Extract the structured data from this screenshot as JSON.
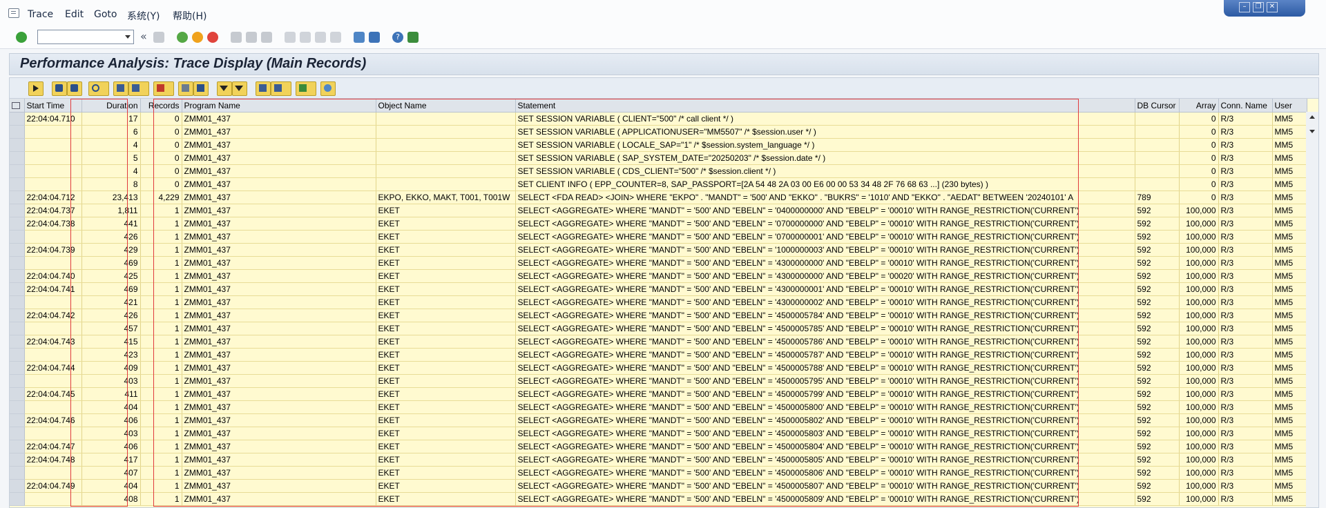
{
  "menu": {
    "items": [
      "Trace",
      "Edit",
      "Goto",
      "系统(Y)",
      "帮助(H)"
    ]
  },
  "command_field": {
    "value": ""
  },
  "window": {
    "title": "Performance Analysis: Trace Display (Main Records)"
  },
  "table": {
    "columns": [
      "Start Time",
      "Duration",
      "Records",
      "Program Name",
      "Object Name",
      "Statement",
      "DB Cursor",
      "Array",
      "Conn. Name",
      "User"
    ],
    "rows": [
      [
        "22:04:04.710",
        "17",
        "0",
        "ZMM01_437",
        "",
        "SET SESSION VARIABLE ( CLIENT=\"500\" /* call client */ )",
        "",
        "0",
        "R/3",
        "MM5"
      ],
      [
        "",
        "6",
        "0",
        "ZMM01_437",
        "",
        "SET SESSION VARIABLE ( APPLICATIONUSER=\"MM5507\" /* $session.user */ )",
        "",
        "0",
        "R/3",
        "MM5"
      ],
      [
        "",
        "4",
        "0",
        "ZMM01_437",
        "",
        "SET SESSION VARIABLE ( LOCALE_SAP=\"1\" /* $session.system_language */ )",
        "",
        "0",
        "R/3",
        "MM5"
      ],
      [
        "",
        "5",
        "0",
        "ZMM01_437",
        "",
        "SET SESSION VARIABLE ( SAP_SYSTEM_DATE=\"20250203\" /* $session.date */ )",
        "",
        "0",
        "R/3",
        "MM5"
      ],
      [
        "",
        "4",
        "0",
        "ZMM01_437",
        "",
        "SET SESSION VARIABLE ( CDS_CLIENT=\"500\" /* $session.client */ )",
        "",
        "0",
        "R/3",
        "MM5"
      ],
      [
        "",
        "8",
        "0",
        "ZMM01_437",
        "",
        "SET CLIENT INFO ( EPP_COUNTER=8, SAP_PASSPORT=[2A 54 48 2A 03 00 E6 00 00 53 34 48 2F 76 68 63 ...] (230 bytes) )",
        "",
        "0",
        "R/3",
        "MM5"
      ],
      [
        "22:04:04.712",
        "23,413",
        "4,229",
        "ZMM01_437",
        "EKPO, EKKO, MAKT, T001, T001W",
        "SELECT <FDA READ> <JOIN>  WHERE \"EKPO\" . \"MANDT\" = '500' AND \"EKKO\" . \"BUKRS\" = '1010' AND \"EKKO\" . \"AEDAT\" BETWEEN '20240101' A",
        "789",
        "0",
        "R/3",
        "MM5"
      ],
      [
        "22:04:04.737",
        "1,811",
        "1",
        "ZMM01_437",
        "EKET",
        "SELECT <AGGREGATE>  WHERE \"MANDT\" = '500' AND \"EBELN\" = '0400000000' AND \"EBELP\" = '00010'   WITH RANGE_RESTRICTION('CURRENT')",
        "592",
        "100,000",
        "R/3",
        "MM5"
      ],
      [
        "22:04:04.738",
        "441",
        "1",
        "ZMM01_437",
        "EKET",
        "SELECT <AGGREGATE>  WHERE \"MANDT\" = '500' AND \"EBELN\" = '0700000000' AND \"EBELP\" = '00010'   WITH RANGE_RESTRICTION('CURRENT')",
        "592",
        "100,000",
        "R/3",
        "MM5"
      ],
      [
        "",
        "426",
        "1",
        "ZMM01_437",
        "EKET",
        "SELECT <AGGREGATE>  WHERE \"MANDT\" = '500' AND \"EBELN\" = '0700000001' AND \"EBELP\" = '00010'   WITH RANGE_RESTRICTION('CURRENT')",
        "592",
        "100,000",
        "R/3",
        "MM5"
      ],
      [
        "22:04:04.739",
        "429",
        "1",
        "ZMM01_437",
        "EKET",
        "SELECT <AGGREGATE>  WHERE \"MANDT\" = '500' AND \"EBELN\" = '1000000003' AND \"EBELP\" = '00010'   WITH RANGE_RESTRICTION('CURRENT')",
        "592",
        "100,000",
        "R/3",
        "MM5"
      ],
      [
        "",
        "469",
        "1",
        "ZMM01_437",
        "EKET",
        "SELECT <AGGREGATE>  WHERE \"MANDT\" = '500' AND \"EBELN\" = '4300000000' AND \"EBELP\" = '00010'   WITH RANGE_RESTRICTION('CURRENT')",
        "592",
        "100,000",
        "R/3",
        "MM5"
      ],
      [
        "22:04:04.740",
        "425",
        "1",
        "ZMM01_437",
        "EKET",
        "SELECT <AGGREGATE>  WHERE \"MANDT\" = '500' AND \"EBELN\" = '4300000000' AND \"EBELP\" = '00020'   WITH RANGE_RESTRICTION('CURRENT')",
        "592",
        "100,000",
        "R/3",
        "MM5"
      ],
      [
        "22:04:04.741",
        "469",
        "1",
        "ZMM01_437",
        "EKET",
        "SELECT <AGGREGATE>  WHERE \"MANDT\" = '500' AND \"EBELN\" = '4300000001' AND \"EBELP\" = '00010'   WITH RANGE_RESTRICTION('CURRENT')",
        "592",
        "100,000",
        "R/3",
        "MM5"
      ],
      [
        "",
        "421",
        "1",
        "ZMM01_437",
        "EKET",
        "SELECT <AGGREGATE>  WHERE \"MANDT\" = '500' AND \"EBELN\" = '4300000002' AND \"EBELP\" = '00010'   WITH RANGE_RESTRICTION('CURRENT')",
        "592",
        "100,000",
        "R/3",
        "MM5"
      ],
      [
        "22:04:04.742",
        "426",
        "1",
        "ZMM01_437",
        "EKET",
        "SELECT <AGGREGATE>  WHERE \"MANDT\" = '500' AND \"EBELN\" = '4500005784' AND \"EBELP\" = '00010'   WITH RANGE_RESTRICTION('CURRENT')",
        "592",
        "100,000",
        "R/3",
        "MM5"
      ],
      [
        "",
        "457",
        "1",
        "ZMM01_437",
        "EKET",
        "SELECT <AGGREGATE>  WHERE \"MANDT\" = '500' AND \"EBELN\" = '4500005785' AND \"EBELP\" = '00010'   WITH RANGE_RESTRICTION('CURRENT')",
        "592",
        "100,000",
        "R/3",
        "MM5"
      ],
      [
        "22:04:04.743",
        "415",
        "1",
        "ZMM01_437",
        "EKET",
        "SELECT <AGGREGATE>  WHERE \"MANDT\" = '500' AND \"EBELN\" = '4500005786' AND \"EBELP\" = '00010'   WITH RANGE_RESTRICTION('CURRENT')",
        "592",
        "100,000",
        "R/3",
        "MM5"
      ],
      [
        "",
        "423",
        "1",
        "ZMM01_437",
        "EKET",
        "SELECT <AGGREGATE>  WHERE \"MANDT\" = '500' AND \"EBELN\" = '4500005787' AND \"EBELP\" = '00010'   WITH RANGE_RESTRICTION('CURRENT')",
        "592",
        "100,000",
        "R/3",
        "MM5"
      ],
      [
        "22:04:04.744",
        "409",
        "1",
        "ZMM01_437",
        "EKET",
        "SELECT <AGGREGATE>  WHERE \"MANDT\" = '500' AND \"EBELN\" = '4500005788' AND \"EBELP\" = '00010'   WITH RANGE_RESTRICTION('CURRENT')",
        "592",
        "100,000",
        "R/3",
        "MM5"
      ],
      [
        "",
        "403",
        "1",
        "ZMM01_437",
        "EKET",
        "SELECT <AGGREGATE>  WHERE \"MANDT\" = '500' AND \"EBELN\" = '4500005795' AND \"EBELP\" = '00010'   WITH RANGE_RESTRICTION('CURRENT')",
        "592",
        "100,000",
        "R/3",
        "MM5"
      ],
      [
        "22:04:04.745",
        "411",
        "1",
        "ZMM01_437",
        "EKET",
        "SELECT <AGGREGATE>  WHERE \"MANDT\" = '500' AND \"EBELN\" = '4500005799' AND \"EBELP\" = '00010'   WITH RANGE_RESTRICTION('CURRENT')",
        "592",
        "100,000",
        "R/3",
        "MM5"
      ],
      [
        "",
        "404",
        "1",
        "ZMM01_437",
        "EKET",
        "SELECT <AGGREGATE>  WHERE \"MANDT\" = '500' AND \"EBELN\" = '4500005800' AND \"EBELP\" = '00010'   WITH RANGE_RESTRICTION('CURRENT')",
        "592",
        "100,000",
        "R/3",
        "MM5"
      ],
      [
        "22:04:04.746",
        "406",
        "1",
        "ZMM01_437",
        "EKET",
        "SELECT <AGGREGATE>  WHERE \"MANDT\" = '500' AND \"EBELN\" = '4500005802' AND \"EBELP\" = '00010'   WITH RANGE_RESTRICTION('CURRENT')",
        "592",
        "100,000",
        "R/3",
        "MM5"
      ],
      [
        "",
        "403",
        "1",
        "ZMM01_437",
        "EKET",
        "SELECT <AGGREGATE>  WHERE \"MANDT\" = '500' AND \"EBELN\" = '4500005803' AND \"EBELP\" = '00010'   WITH RANGE_RESTRICTION('CURRENT')",
        "592",
        "100,000",
        "R/3",
        "MM5"
      ],
      [
        "22:04:04.747",
        "406",
        "1",
        "ZMM01_437",
        "EKET",
        "SELECT <AGGREGATE>  WHERE \"MANDT\" = '500' AND \"EBELN\" = '4500005804' AND \"EBELP\" = '00010'   WITH RANGE_RESTRICTION('CURRENT')",
        "592",
        "100,000",
        "R/3",
        "MM5"
      ],
      [
        "22:04:04.748",
        "417",
        "1",
        "ZMM01_437",
        "EKET",
        "SELECT <AGGREGATE>  WHERE \"MANDT\" = '500' AND \"EBELN\" = '4500005805' AND \"EBELP\" = '00010'   WITH RANGE_RESTRICTION('CURRENT')",
        "592",
        "100,000",
        "R/3",
        "MM5"
      ],
      [
        "",
        "407",
        "1",
        "ZMM01_437",
        "EKET",
        "SELECT <AGGREGATE>  WHERE \"MANDT\" = '500' AND \"EBELN\" = '4500005806' AND \"EBELP\" = '00010'   WITH RANGE_RESTRICTION('CURRENT')",
        "592",
        "100,000",
        "R/3",
        "MM5"
      ],
      [
        "22:04:04.749",
        "404",
        "1",
        "ZMM01_437",
        "EKET",
        "SELECT <AGGREGATE>  WHERE \"MANDT\" = '500' AND \"EBELN\" = '4500005807' AND \"EBELP\" = '00010'   WITH RANGE_RESTRICTION('CURRENT')",
        "592",
        "100,000",
        "R/3",
        "MM5"
      ],
      [
        "",
        "408",
        "1",
        "ZMM01_437",
        "EKET",
        "SELECT <AGGREGATE>  WHERE \"MANDT\" = '500' AND \"EBELN\" = '4500005809' AND \"EBELP\" = '00010'   WITH RANGE_RESTRICTION('CURRENT')",
        "592",
        "100,000",
        "R/3",
        "MM5"
      ]
    ]
  },
  "colors": {
    "grid_bg": "#fffad0",
    "highlight": "#e0393c",
    "header_bg": "#dfe4ea"
  }
}
